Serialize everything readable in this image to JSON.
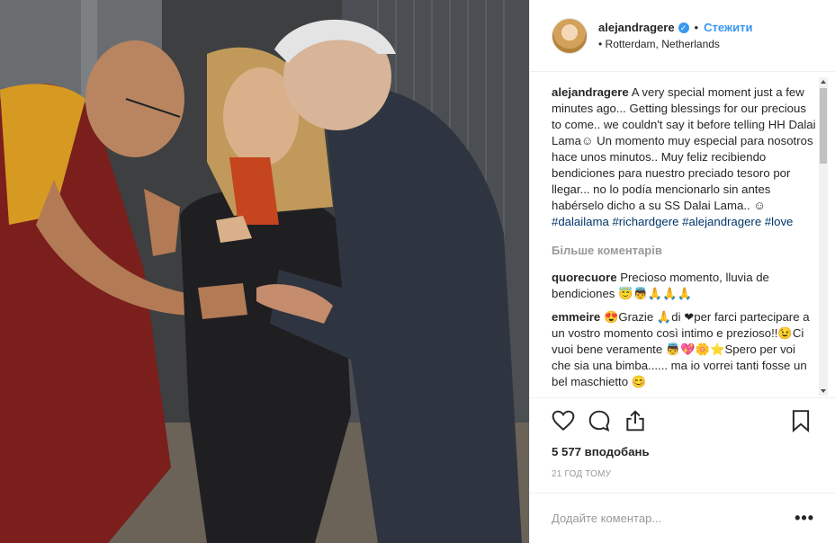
{
  "post": {
    "photo_alt": "",
    "header": {
      "username": "alejandragere",
      "follow_label": "Стежити",
      "separator": "•",
      "location": "• Rotterdam, Netherlands"
    },
    "caption": {
      "username": "alejandragere",
      "text": "A very special moment just a few minutes ago... Getting blessings for our precious to come.. we couldn't say it before telling HH Dalai Lama☺ Un momento muy especial para nosotros hace unos minutos.. Muy feliz recibiendo bendiciones para nuestro preciado tesoro por llegar... no lo podía mencionarlo sin antes habérselo dicho a su SS Dalai Lama.. ☺ ",
      "hashtags": [
        "#dalailama",
        "#richardgere",
        "#alejandragere",
        "#love"
      ]
    },
    "load_more_label": "Більше коментарів",
    "comments": [
      {
        "username": "quorecuore",
        "text": "Precioso momento, lluvia de bendiciones 😇👼🙏🙏🙏"
      },
      {
        "username": "emmeire",
        "text": "😍Grazie 🙏di ❤per farci partecipare a un vostro momento così intimo e prezioso!!😉Ci vuoi bene veramente 👼💖🌼⭐Spero per voi che sia una bimba...... ma io vorrei tanti fosse un bel maschietto 😊"
      }
    ],
    "actions": {
      "like_icon": "heart-icon",
      "comment_icon": "comment-bubble-icon",
      "share_icon": "share-icon",
      "save_icon": "bookmark-icon"
    },
    "likes_text": "5 577 вподобань",
    "time_text": "21 ГОД ТОМУ",
    "add_comment_placeholder": "Додайте коментар...",
    "more_options": "•••",
    "colors": {
      "link": "#3897f0",
      "hashtag": "#003569",
      "muted": "#999999",
      "text": "#262626"
    }
  }
}
